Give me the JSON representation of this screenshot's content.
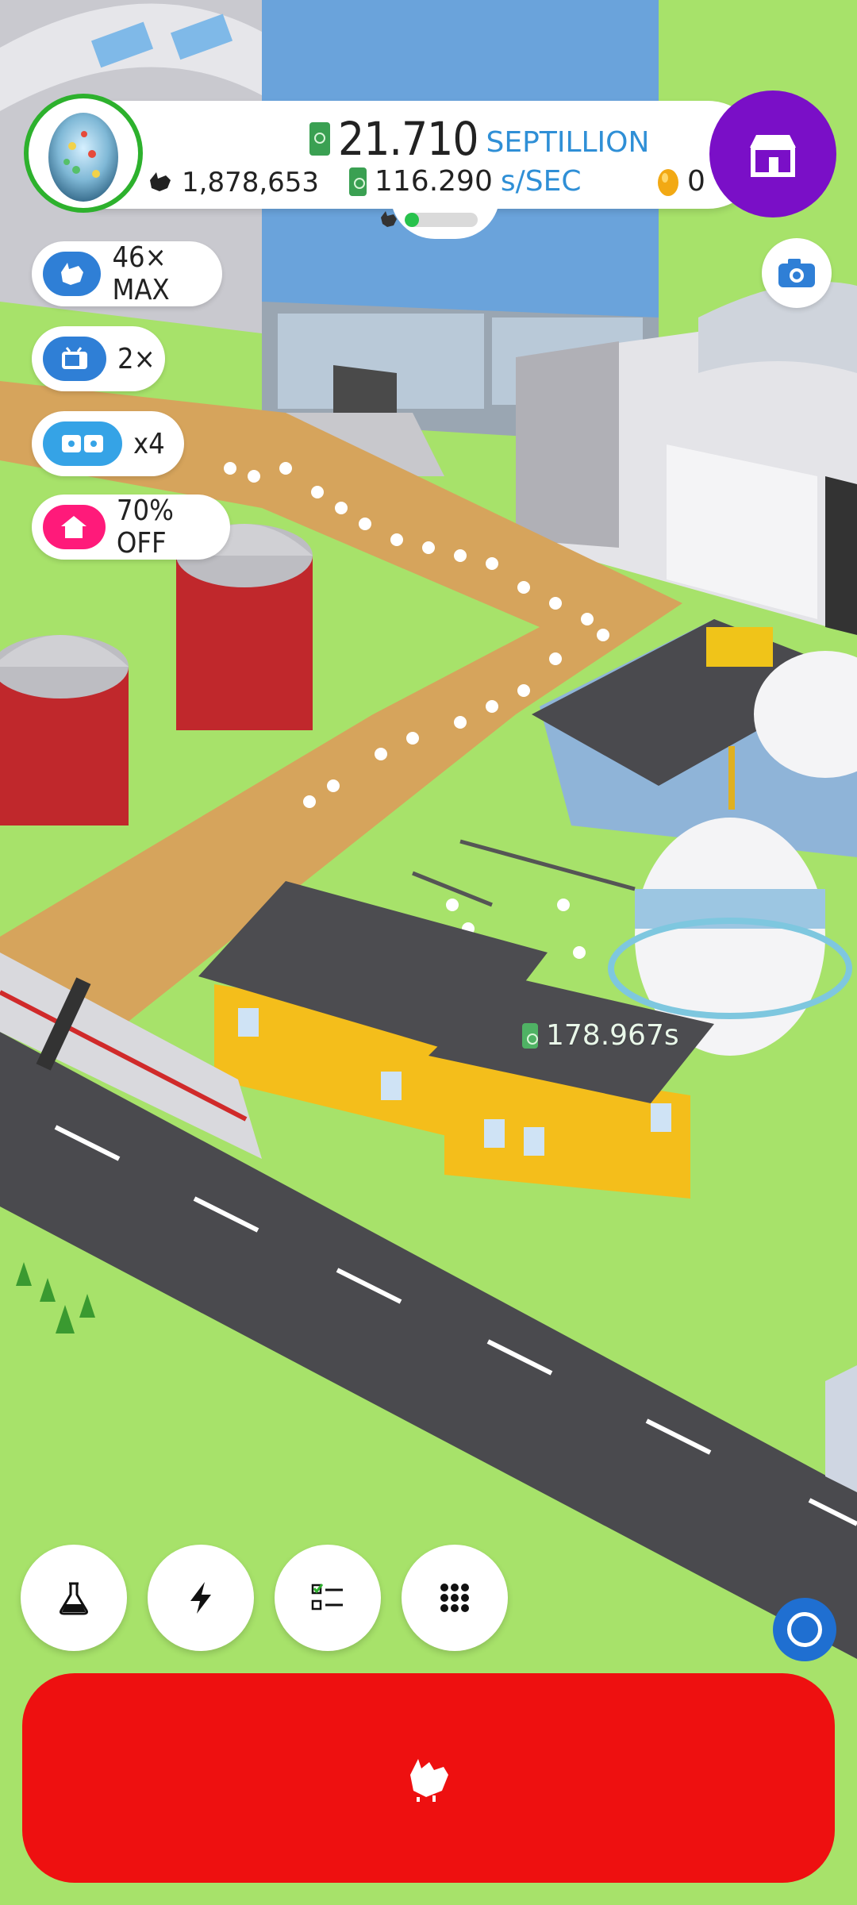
{
  "hud": {
    "money_value": "21.710",
    "money_unit": "SEPTILLION",
    "rate_value": "116.290",
    "rate_unit": "s/SEC",
    "chicken_count": "1,878,653",
    "egg_count": "0",
    "hatchery_fill_fraction": 0.2
  },
  "boosts": [
    {
      "label": "46× MAX",
      "icon": "chicken-icon",
      "color": "#2f7fd6"
    },
    {
      "label": "2×",
      "icon": "tv-icon",
      "color": "#2f7fd6"
    },
    {
      "label": "x4",
      "icon": "egg-boost-icon",
      "color": "#35a3e6"
    },
    {
      "label": "70% OFF",
      "icon": "home-icon",
      "color": "#ff1a7a"
    }
  ],
  "world": {
    "floating_income": "178.967s"
  },
  "bottom": {
    "buttons": [
      "flask-icon",
      "lightning-icon",
      "checklist-icon",
      "grid-icon"
    ]
  },
  "colors": {
    "shop": "#7a0fc7",
    "hatch_button": "#ee1010",
    "grass": "#a7e26a"
  }
}
